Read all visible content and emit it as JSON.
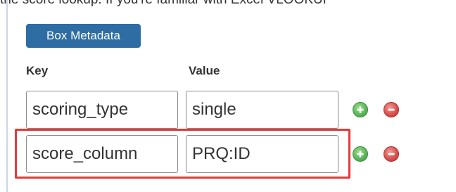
{
  "intro": {
    "text": "the score lookup. If you're familiar with Excel VLOOKUP"
  },
  "metadata_button": {
    "label": "Box Metadata"
  },
  "columns": {
    "key_header": "Key",
    "value_header": "Value"
  },
  "rows": [
    {
      "key": "scoring_type",
      "value": "single"
    },
    {
      "key": "score_column",
      "value": "PRQ:ID"
    }
  ],
  "icons": {
    "add": "plus-circle-icon",
    "remove": "minus-circle-icon"
  },
  "colors": {
    "button": "#2e6da4",
    "add": "#5cb85c",
    "remove": "#d9534f",
    "highlight": "#e63939"
  }
}
